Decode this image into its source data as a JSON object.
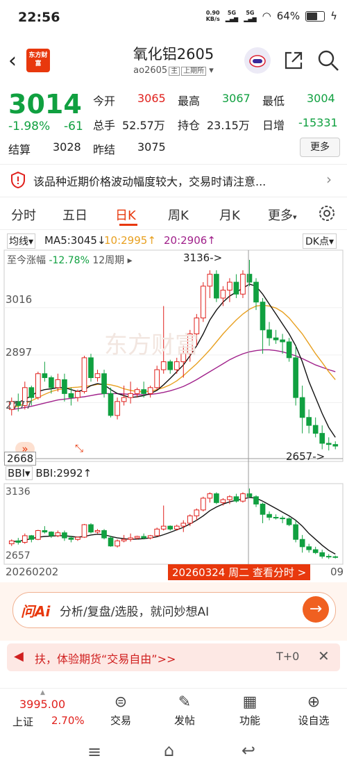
{
  "status": {
    "time": "22:56",
    "speed": "0.90",
    "speed_unit": "KB/s",
    "net1": "5G",
    "net2": "5G",
    "battery": "64%"
  },
  "header": {
    "logo": "东方财富",
    "title": "氧化铝2605",
    "code": "ao2605",
    "tag1": "主",
    "tag2": "上期所"
  },
  "quote": {
    "price": "3014",
    "pct": "-1.98%",
    "change": "-61",
    "open_label": "今开",
    "open": "3065",
    "high_label": "最高",
    "high": "3067",
    "low_label": "最低",
    "low": "3004",
    "vol_label": "总手",
    "vol": "52.57万",
    "oi_label": "持仓",
    "oi": "23.15万",
    "dayinc_label": "日增",
    "dayinc": "-15331",
    "settle_label": "结算",
    "settle": "3028",
    "prev_label": "昨结",
    "prev": "3075",
    "more": "更多"
  },
  "notice": "该品种近期价格波动幅度较大，交易时请注意...",
  "tabs": [
    "分时",
    "五日",
    "日K",
    "周K",
    "月K",
    "更多"
  ],
  "indicator": {
    "name": "均线",
    "ma5": "MA5:3045",
    "ma10": "10:2995",
    "ma20": "20:2906",
    "dk": "DK点"
  },
  "chart_data": {
    "type": "candlestick",
    "period_change": "至今涨幅",
    "period_change_val": "-12.78%",
    "period_weeks": "12周期",
    "y_ticks": [
      "3016",
      "2897",
      "2777"
    ],
    "high_label": "3136",
    "low_label": "2657",
    "left_label": "2668",
    "sub_name": "BBI",
    "sub_value": "BBI:2992",
    "sub_high": "3136",
    "sub_low": "2657",
    "date_start": "20260202",
    "date_end_suffix": "09",
    "cursor_date": "20260324 周二 查看分时 >",
    "ylim": [
      2640,
      3150
    ],
    "candles": [
      [
        2760,
        2790,
        2745,
        2780
      ],
      [
        2780,
        2800,
        2755,
        2770
      ],
      [
        2770,
        2830,
        2760,
        2815
      ],
      [
        2815,
        2820,
        2770,
        2790
      ],
      [
        2790,
        2855,
        2785,
        2850
      ],
      [
        2850,
        2880,
        2830,
        2840
      ],
      [
        2840,
        2845,
        2800,
        2815
      ],
      [
        2815,
        2850,
        2805,
        2835
      ],
      [
        2835,
        2850,
        2780,
        2800
      ],
      [
        2800,
        2815,
        2770,
        2790
      ],
      [
        2790,
        2810,
        2780,
        2805
      ],
      [
        2805,
        2895,
        2800,
        2890
      ],
      [
        2890,
        2900,
        2830,
        2840
      ],
      [
        2840,
        2860,
        2830,
        2850
      ],
      [
        2850,
        2860,
        2790,
        2800
      ],
      [
        2800,
        2815,
        2740,
        2745
      ],
      [
        2745,
        2790,
        2735,
        2780
      ],
      [
        2780,
        2820,
        2770,
        2790
      ],
      [
        2790,
        2830,
        2775,
        2800
      ],
      [
        2800,
        2815,
        2790,
        2810
      ],
      [
        2810,
        2830,
        2790,
        2800
      ],
      [
        2800,
        2820,
        2790,
        2815
      ],
      [
        2815,
        2870,
        2810,
        2860
      ],
      [
        2860,
        3020,
        2850,
        2880
      ],
      [
        2880,
        2885,
        2850,
        2860
      ],
      [
        2860,
        2890,
        2850,
        2880
      ],
      [
        2880,
        2920,
        2840,
        2900
      ],
      [
        2900,
        2960,
        2880,
        2950
      ],
      [
        2950,
        3000,
        2920,
        2990
      ],
      [
        2990,
        3080,
        2980,
        3070
      ],
      [
        3070,
        3110,
        3040,
        3100
      ],
      [
        3100,
        3110,
        3030,
        3040
      ],
      [
        3040,
        3070,
        3020,
        3060
      ],
      [
        3060,
        3090,
        3030,
        3080
      ],
      [
        3080,
        3100,
        3040,
        3050
      ],
      [
        3050,
        3110,
        3040,
        3100
      ],
      [
        3100,
        3136,
        3070,
        3080
      ],
      [
        3080,
        3090,
        3010,
        3030
      ],
      [
        3030,
        3040,
        2900,
        2960
      ],
      [
        2960,
        2980,
        2920,
        2940
      ],
      [
        2940,
        2960,
        2925,
        2935
      ],
      [
        2935,
        2950,
        2900,
        2930
      ],
      [
        2930,
        2940,
        2880,
        2890
      ],
      [
        2890,
        2920,
        2770,
        2790
      ],
      [
        2790,
        2820,
        2700,
        2740
      ],
      [
        2740,
        2760,
        2700,
        2720
      ],
      [
        2720,
        2740,
        2690,
        2700
      ],
      [
        2700,
        2720,
        2660,
        2675
      ],
      [
        2675,
        2690,
        2657,
        2672
      ],
      [
        2672,
        2680,
        2660,
        2668
      ]
    ],
    "ma_black": [
      2775,
      2778,
      2785,
      2795,
      2805,
      2810,
      2812,
      2815,
      2815,
      2810,
      2805,
      2810,
      2820,
      2825,
      2822,
      2810,
      2800,
      2795,
      2790,
      2792,
      2795,
      2800,
      2808,
      2822,
      2838,
      2855,
      2872,
      2895,
      2920,
      2950,
      2985,
      3010,
      3030,
      3045,
      3055,
      3065,
      3075,
      3070,
      3050,
      3025,
      3000,
      2975,
      2950,
      2920,
      2880,
      2830,
      2790,
      2750,
      2715,
      2690
    ],
    "ma_orange": [
      2765,
      2768,
      2775,
      2782,
      2790,
      2798,
      2805,
      2810,
      2812,
      2815,
      2816,
      2818,
      2820,
      2823,
      2824,
      2822,
      2818,
      2812,
      2808,
      2805,
      2805,
      2806,
      2810,
      2815,
      2822,
      2832,
      2845,
      2860,
      2875,
      2892,
      2910,
      2930,
      2950,
      2968,
      2985,
      3000,
      3012,
      3020,
      3022,
      3020,
      3015,
      3005,
      2990,
      2970,
      2950,
      2925,
      2900,
      2878,
      2855,
      2835
    ],
    "ma_purple": [
      2760,
      2762,
      2765,
      2768,
      2772,
      2776,
      2780,
      2784,
      2786,
      2788,
      2790,
      2792,
      2795,
      2798,
      2800,
      2800,
      2800,
      2799,
      2798,
      2797,
      2797,
      2798,
      2800,
      2803,
      2807,
      2812,
      2818,
      2826,
      2835,
      2845,
      2855,
      2865,
      2875,
      2885,
      2893,
      2900,
      2905,
      2908,
      2910,
      2910,
      2908,
      2905,
      2900,
      2895,
      2888,
      2880,
      2872,
      2866,
      2860,
      2855
    ]
  },
  "ai": {
    "logo": "问Ai",
    "text": "分析/复盘/选股，就问妙想AI"
  },
  "promo": {
    "text": "扶，体验期货“交易自由”>>",
    "right": "T+0"
  },
  "bottom": {
    "index_val": "3995.00",
    "index_name": "上证",
    "index_pct": "2.70%",
    "nav": [
      "交易",
      "发帖",
      "功能",
      "设自选"
    ]
  }
}
